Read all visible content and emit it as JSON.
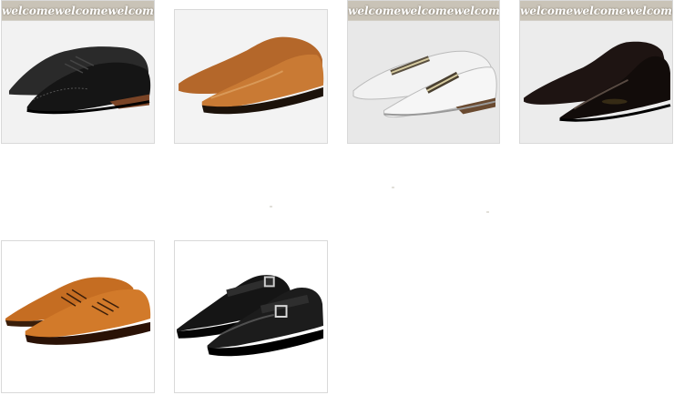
{
  "gallery": {
    "products": [
      {
        "banner": [
          "welcome",
          "welcome",
          "welcome"
        ],
        "shoe": "black brogue oxford lace-up",
        "watermark": ""
      },
      {
        "banner": [],
        "shoe": "tan leather slip-on loafer",
        "watermark": ""
      },
      {
        "banner": [
          "welcome",
          "welcome",
          "welcome"
        ],
        "shoe": "white slip-on loafer with striped strap",
        "watermark": ""
      },
      {
        "banner": [
          "welcome",
          "welcome",
          "welcome"
        ],
        "shoe": "black patent slip-on loafer",
        "watermark": ""
      },
      {
        "banner": [],
        "shoe": "tan leather lace-up derby",
        "watermark": ""
      },
      {
        "banner": [],
        "shoe": "black monk strap loafer",
        "watermark": ""
      }
    ]
  },
  "colors": {
    "banner_bg": "#c9c3b7",
    "tile_border": "#d9d9d9",
    "leather_black": "#1a1a1a",
    "leather_tan": "#c7782d",
    "leather_white": "#ececec"
  }
}
